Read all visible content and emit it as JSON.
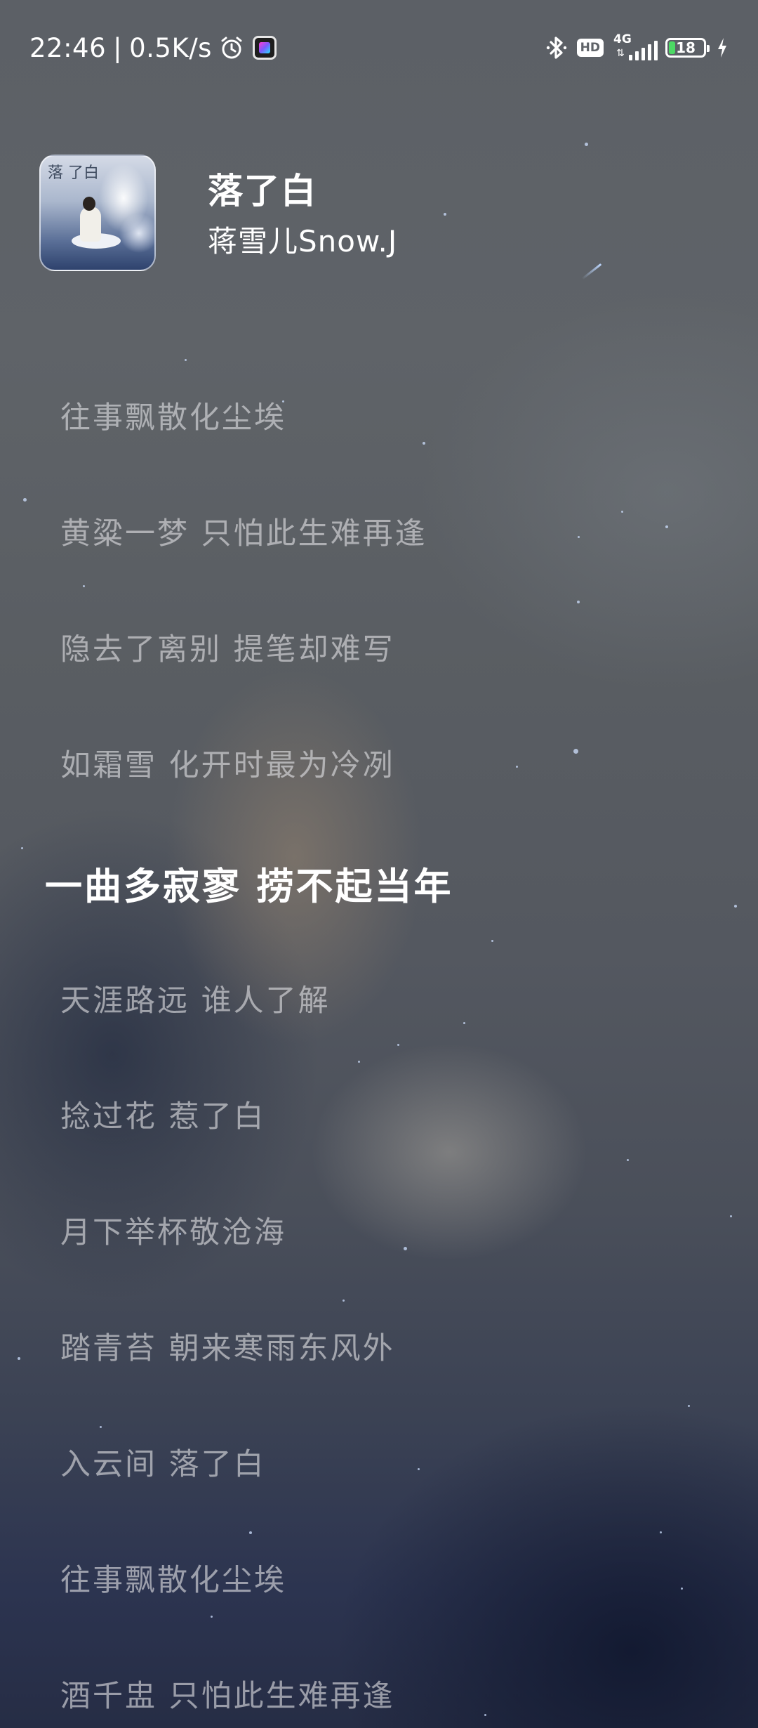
{
  "status_bar": {
    "time": "22:46",
    "separator": "|",
    "net_speed": "0.5K/s",
    "alarm_icon": "alarm-clock-icon",
    "app_icon": "app-notification-icon",
    "bluetooth_icon": "bluetooth-icon",
    "hd_label": "HD",
    "network_type": "4G",
    "battery_level": "18",
    "charging_icon": "charging-bolt-icon"
  },
  "song": {
    "title": "落了白",
    "artist": "蒋雪儿Snow.J",
    "cover_text": "落 了白"
  },
  "lyrics": [
    {
      "text": "往事飘散化尘埃",
      "active": false
    },
    {
      "text": "黄粱一梦 只怕此生难再逢",
      "active": false
    },
    {
      "text": "隐去了离别 提笔却难写",
      "active": false
    },
    {
      "text": "如霜雪 化开时最为冷冽",
      "active": false
    },
    {
      "text": "一曲多寂寥 捞不起当年",
      "active": true
    },
    {
      "text": "天涯路远 谁人了解",
      "active": false
    },
    {
      "text": "捻过花 惹了白",
      "active": false
    },
    {
      "text": "月下举杯敬沧海",
      "active": false
    },
    {
      "text": "踏青苔 朝来寒雨东风外",
      "active": false
    },
    {
      "text": "入云间 落了白",
      "active": false
    },
    {
      "text": "往事飘散化尘埃",
      "active": false
    },
    {
      "text": "酒千盅 只怕此生难再逢",
      "active": false
    }
  ],
  "colors": {
    "active_lyric": "#ffffff",
    "inactive_lyric": "#e1e1e4",
    "battery_fill": "#4cd964"
  }
}
